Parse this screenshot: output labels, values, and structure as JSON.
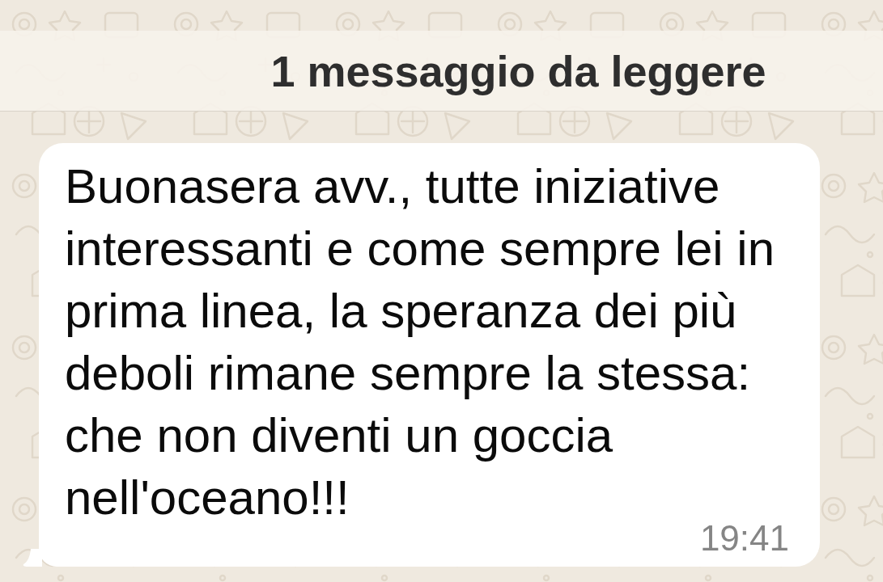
{
  "banner": {
    "text": "1 messaggio da leggere"
  },
  "messages": [
    {
      "kind": "incoming",
      "text": "Buonasera avv., tutte iniziative interessanti e come sempre lei in prima linea, la speranza dei più deboli rimane sempre la stessa: che non diventi un goccia nell'oceano!!!",
      "time": "19:41"
    }
  ]
}
